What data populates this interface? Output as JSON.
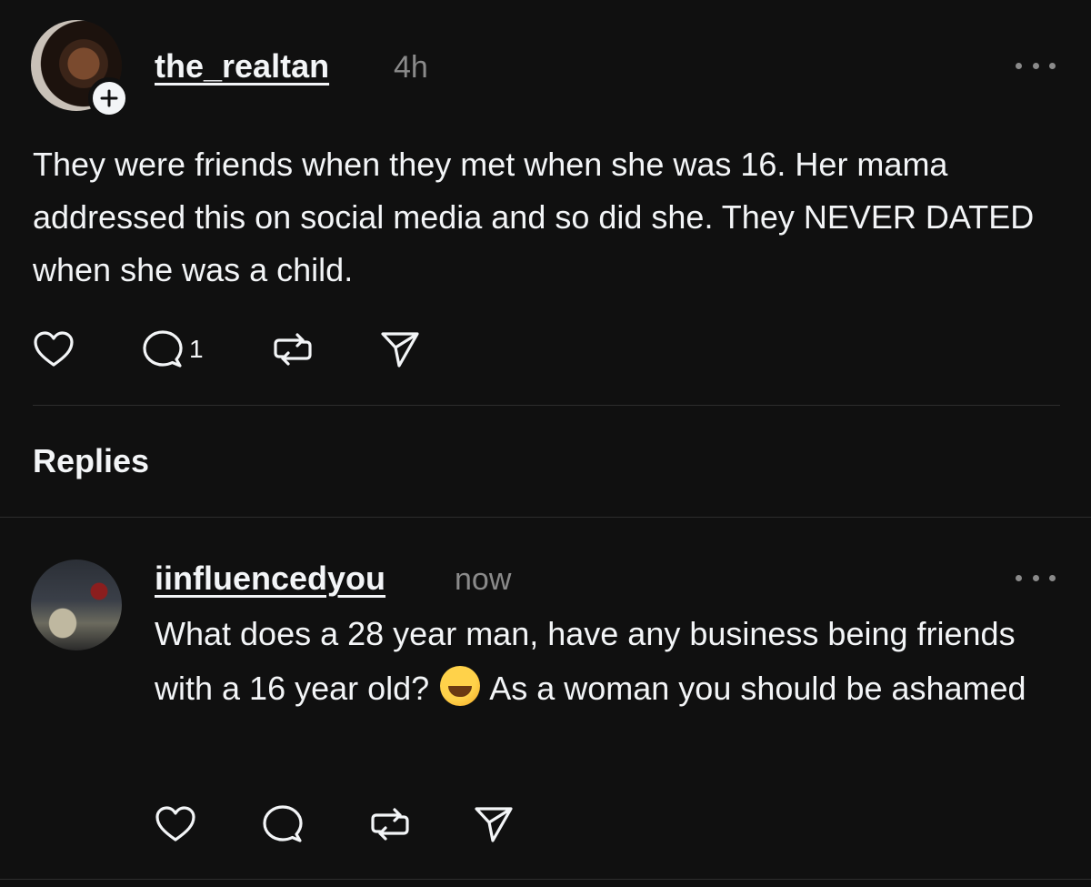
{
  "post": {
    "username": "the_realtan",
    "timestamp": "4h",
    "text": "They were friends when they met when she was 16. Her mama addressed this on social media and so did she. They NEVER DATED when she was a child.",
    "reply_count": "1",
    "icons": {
      "like": "heart-icon",
      "comment": "comment-bubble-icon",
      "repost": "repost-icon",
      "share": "send-icon",
      "more": "more-horizontal-icon",
      "follow": "plus-icon"
    }
  },
  "replies_heading": "Replies",
  "reply": {
    "username": "iinfluencedyou",
    "timestamp": "now",
    "text_before_emoji": "What does a 28 year man, have any business being friends with a 16 year old?",
    "emoji": "rolling-on-floor-laughing-emoji",
    "text_after_emoji": "As a woman you should be ashamed"
  },
  "colors": {
    "background": "#101010",
    "text_primary": "#f3f5f7",
    "text_secondary": "#8a8a8a",
    "divider": "#2d2d2d"
  }
}
